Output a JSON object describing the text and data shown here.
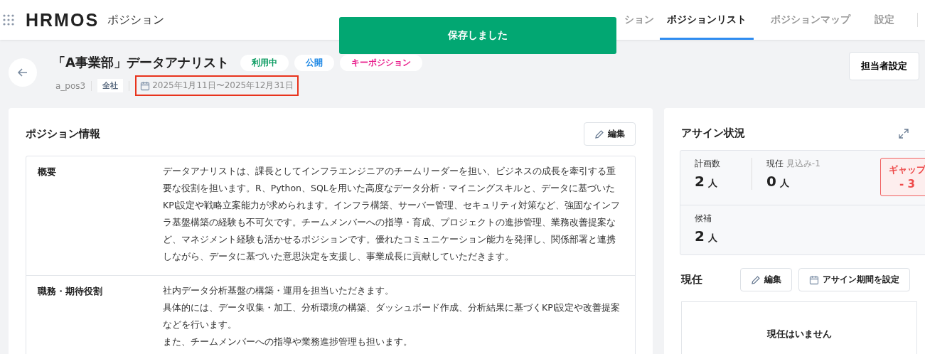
{
  "header": {
    "logo": "HRMOS",
    "product": "ポジション",
    "tabs": [
      {
        "label": "ション",
        "selected": false
      },
      {
        "label": "ポジションリスト",
        "selected": true
      },
      {
        "label": "ポジションマップ",
        "selected": false
      },
      {
        "label": "設定",
        "selected": false
      }
    ]
  },
  "toast": {
    "message": "保存しました"
  },
  "position": {
    "title": "「A事業部」データアナリスト",
    "tags": [
      {
        "label": "利用中",
        "color": "#0f9d64"
      },
      {
        "label": "公開",
        "color": "#1e88e5"
      },
      {
        "label": "キーポジション",
        "color": "#e91e8c"
      }
    ],
    "code": "a_pos3",
    "scope": "全社",
    "period": {
      "text": "2025年1月11日〜2025年12月31日",
      "highlighted": true
    },
    "owner_button": "担当者設定"
  },
  "info": {
    "title": "ポジション情報",
    "edit": "編集",
    "rows": [
      {
        "label": "概要",
        "lines": [
          "データアナリストは、課長としてインフラエンジニアのチームリーダーを担い、ビジネスの成長を牽引する重要な役割を担います。R、Python、SQLを用いた高度なデータ分析・マイニングスキルと、データに基づいたKPI設定や戦略立案能力が求められます。インフラ構築、サーバー管理、セキュリティ対策など、強固なインフラ基盤構築の経験も不可欠です。チームメンバーへの指導・育成、プロジェクトの進捗管理、業務改善提案など、マネジメント経験も活かせるポジションです。優れたコミュニケーション能力を発揮し、関係部署と連携しながら、データに基づいた意思決定を支援し、事業成長に貢献していただきます。"
        ]
      },
      {
        "label": "職務・期待役割",
        "lines": [
          "社内データ分析基盤の構築・運用を担当いただきます。",
          "具体的には、データ収集・加工、分析環境の構築、ダッシュボード作成、分析結果に基づくKPI設定や改善提案などを行います。",
          "また、チームメンバーへの指導や業務進捗管理も担います。"
        ]
      }
    ]
  },
  "assign": {
    "title": "アサイン状況",
    "planned": {
      "label": "計画数",
      "value": "2",
      "unit": "人"
    },
    "current": {
      "label": "現任",
      "note": "見込み-1",
      "value": "0",
      "unit": "人"
    },
    "gap": {
      "label": "ギャップ",
      "value": "- 3"
    },
    "candidates": {
      "label": "候補",
      "value": "2",
      "unit": "人"
    },
    "incumbent": {
      "title": "現任",
      "edit": "編集",
      "period_button": "アサイン期間を設定",
      "empty": "現任はいません"
    }
  }
}
